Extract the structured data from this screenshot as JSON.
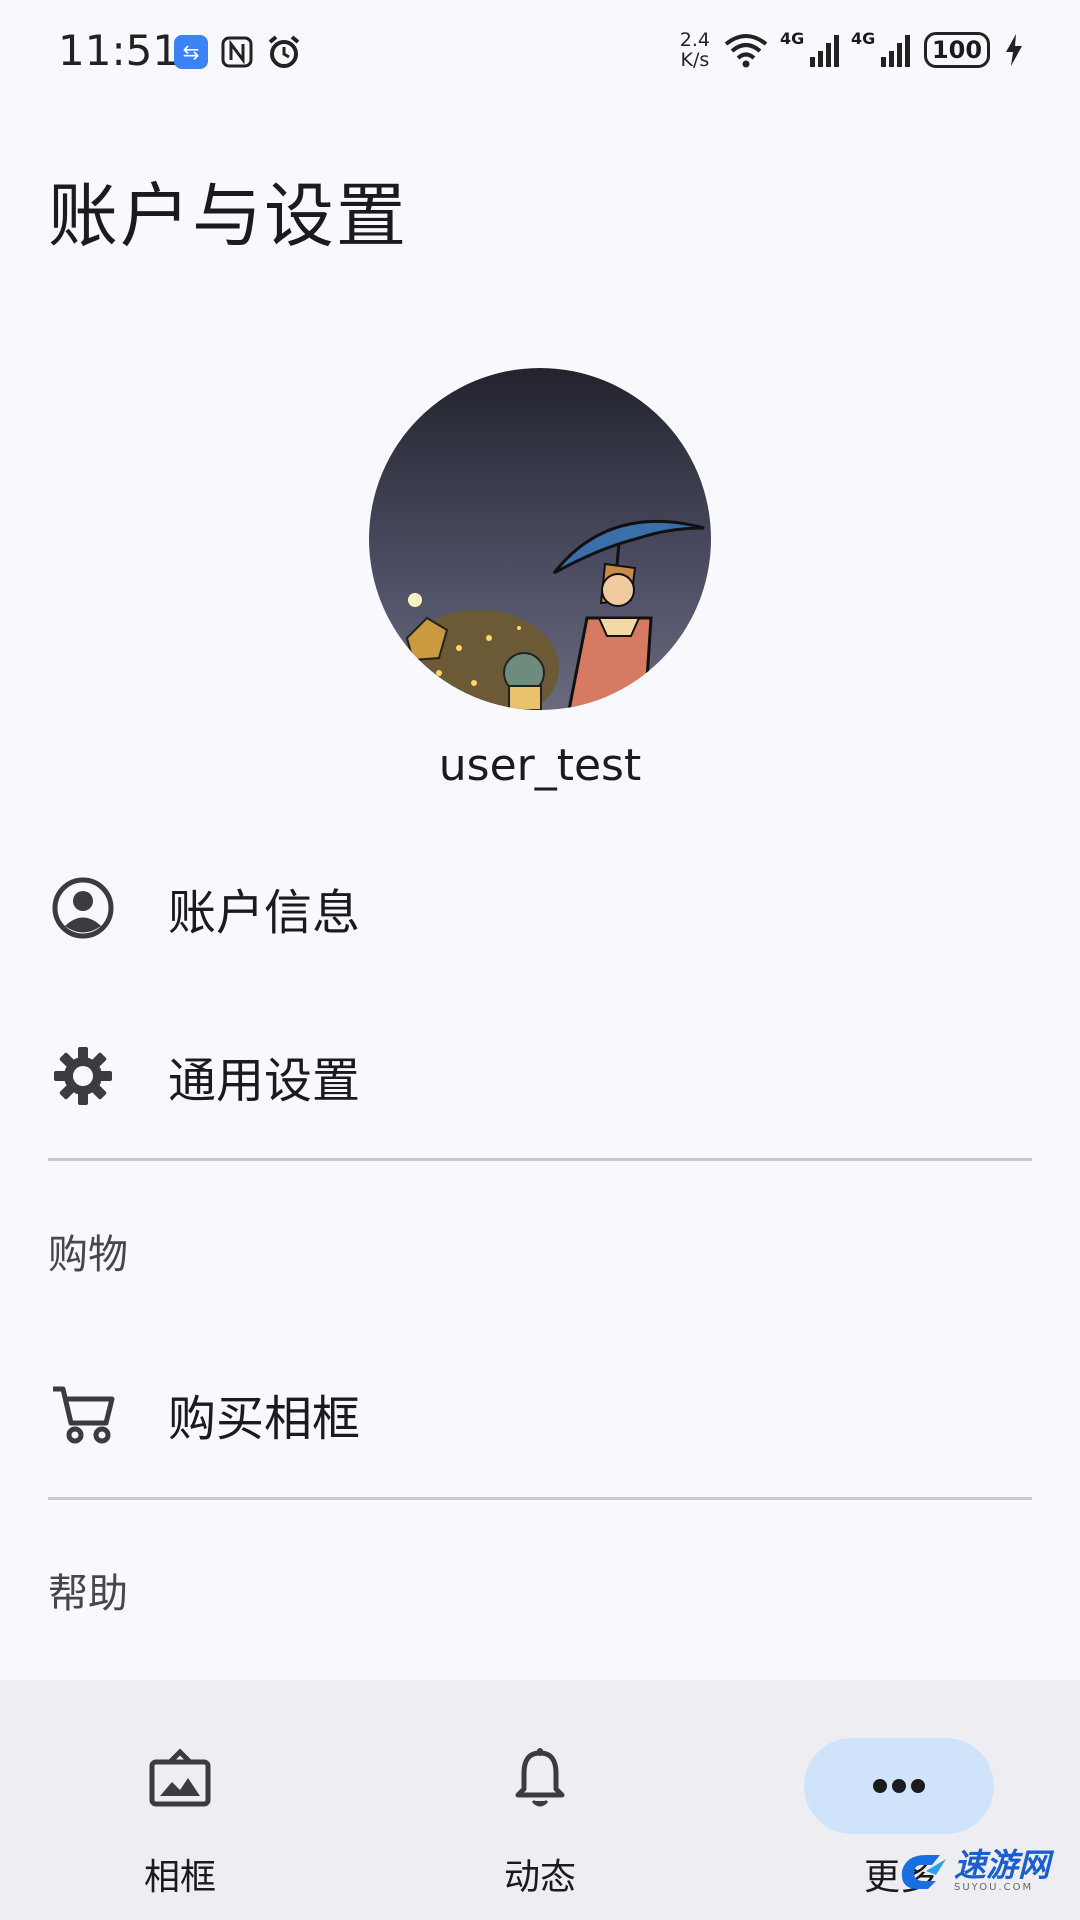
{
  "status_bar": {
    "time": "11:51",
    "net_speed_value": "2.4",
    "net_speed_unit": "K/s",
    "signal1_label": "4G",
    "signal2_label": "4G",
    "battery": "100"
  },
  "page": {
    "title": "账户与设置"
  },
  "profile": {
    "username": "user_test"
  },
  "menu": {
    "account_info": "账户信息",
    "general_settings": "通用设置"
  },
  "sections": {
    "shopping": {
      "header": "购物",
      "buy_frame": "购买相框"
    },
    "help": {
      "header": "帮助"
    }
  },
  "bottom_nav": {
    "items": [
      {
        "label": "相框",
        "icon": "photo-frame-icon"
      },
      {
        "label": "动态",
        "icon": "bell-icon"
      },
      {
        "label": "更多",
        "icon": "more-horiz-icon",
        "active": true
      }
    ]
  },
  "watermark": {
    "text": "速游网",
    "subtext": "SUYOU.COM"
  },
  "colors": {
    "background": "#f9f8fd",
    "nav_background": "#eeedf2",
    "active_pill": "#cfe3fb"
  }
}
